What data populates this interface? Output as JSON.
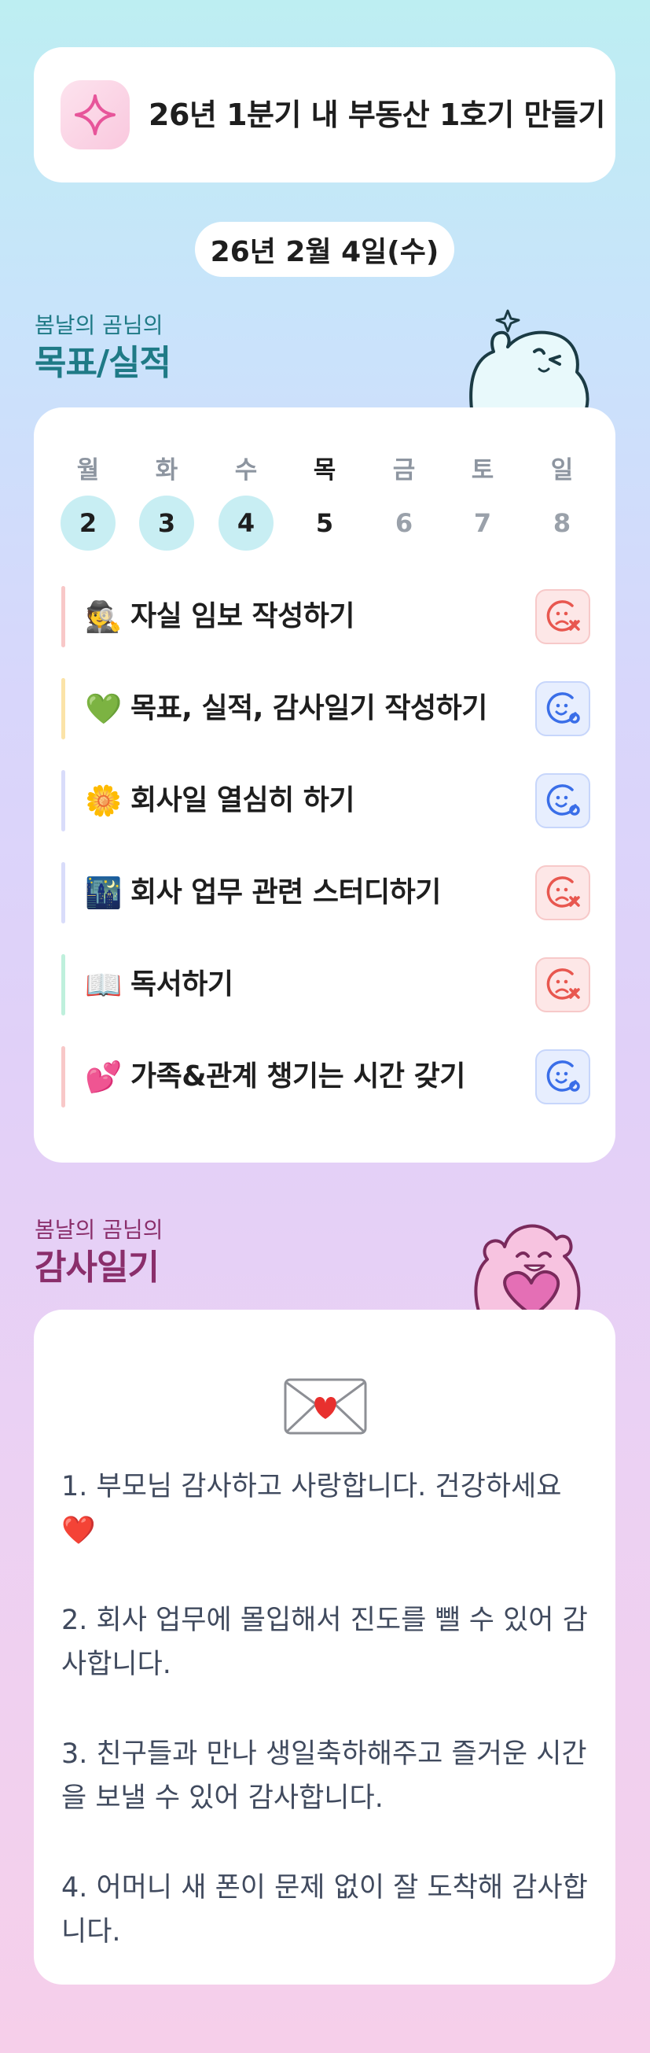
{
  "goal": {
    "title": "26년 1분기 내 부동산 1호기 만들기",
    "icon": "sparkle-icon",
    "accent": "#e7559a"
  },
  "date_label": "26년 2월 4일(수)",
  "goals_section": {
    "subtitle": "봄날의 곰님의",
    "title": "목표/실적",
    "color": "#1f7a86"
  },
  "week": {
    "days": [
      "월",
      "화",
      "수",
      "목",
      "금",
      "토",
      "일"
    ],
    "dates": [
      "2",
      "3",
      "4",
      "5",
      "6",
      "7",
      "8"
    ],
    "today_index": 3
  },
  "tasks": [
    {
      "emoji": "🕵️",
      "label": "자실 임보 작성하기",
      "bar": "#f8c8c8",
      "status": "fail"
    },
    {
      "emoji": "💚",
      "label": "목표, 실적, 감사일기 작성하기",
      "bar": "#fbe3a8",
      "status": "done"
    },
    {
      "emoji": "🌼",
      "label": "회사일 열심히 하기",
      "bar": "#d9dcfa",
      "status": "done"
    },
    {
      "emoji": "🌃",
      "label": "회사 업무 관련 스터디하기",
      "bar": "#d9dcfa",
      "status": "fail"
    },
    {
      "emoji": "📖",
      "label": "독서하기",
      "bar": "#bff0dc",
      "status": "fail"
    },
    {
      "emoji": "💕",
      "label": "가족&관계 챙기는 시간 갖기",
      "bar": "#f8c8c8",
      "status": "done"
    }
  ],
  "gratitude_section": {
    "subtitle": "봄날의 곰님의",
    "title": "감사일기",
    "color": "#8a2e6b"
  },
  "gratitude": {
    "icon": "love-letter-icon",
    "items": [
      "1. 부모님 감사하고 사랑합니다. 건강하세요❤️",
      "2. 회사 업무에 몰입해서 진도를 뺄 수 있어 감사합니다.",
      "3. 친구들과 만나 생일축하해주고 즐거운 시간을 보낼 수 있어 감사합니다.",
      "4. 어머니 새 폰이 문제 없이 잘 도착해 감사합니다."
    ]
  }
}
